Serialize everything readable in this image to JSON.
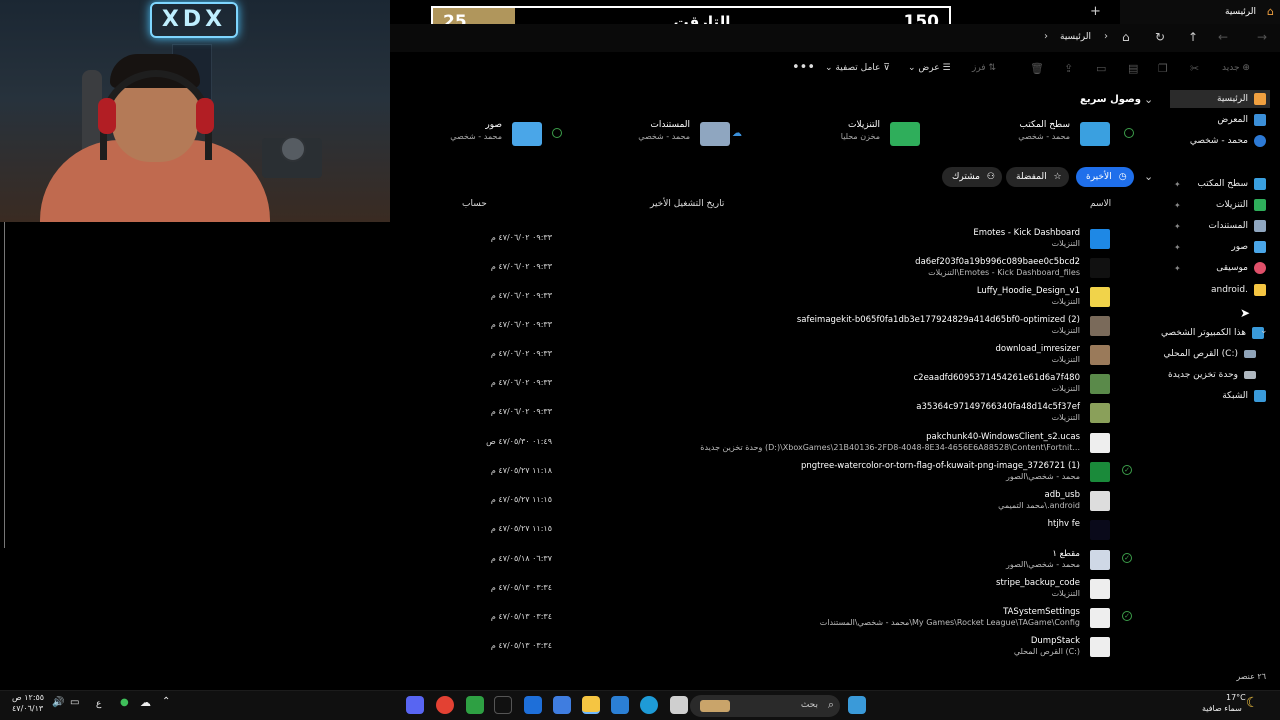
{
  "score": {
    "left_value": "25",
    "title": "التارقت",
    "right_value": "150"
  },
  "window": {
    "tab_title": "الرئيسية",
    "address_crumb": "الرئيسية",
    "toolbar": {
      "new_label": "جديد",
      "sort_label": "فرز",
      "view_label": "عرض",
      "filter_label": "عامل تصفية"
    }
  },
  "sidebar": {
    "items": [
      {
        "label": "الرئيسية",
        "active": true
      },
      {
        "label": "المعرض"
      },
      {
        "label": "محمد - شخصي"
      },
      {
        "label": "سطح المكتب"
      },
      {
        "label": "التنزيلات"
      },
      {
        "label": "المستندات"
      },
      {
        "label": "صور"
      },
      {
        "label": "موسيقى"
      },
      {
        "label": "android."
      },
      {
        "label": "هذا الكمبيوتر الشخصي"
      },
      {
        "label": "القرص المحلي (C:)"
      },
      {
        "label": "وحدة تخزين جديدة"
      },
      {
        "label": "الشبكة"
      }
    ]
  },
  "quick_access": {
    "title": "وصول سريع",
    "cards": [
      {
        "name": "سطح المكتب",
        "sub": "محمد - شخصي"
      },
      {
        "name": "التنزيلات",
        "sub": "مخزن محليا"
      },
      {
        "name": "المستندات",
        "sub": "محمد - شخصي"
      },
      {
        "name": "صور",
        "sub": "محمد - شخصي"
      }
    ]
  },
  "filters": {
    "recent": "الأخيرة",
    "favorites": "المفضلة",
    "shared": "مشترك"
  },
  "columns": {
    "name": "الاسم",
    "last_opened": "تاريخ التشغيل الأخير",
    "account": "حساب"
  },
  "files": [
    {
      "name": "Emotes - Kick Dashboard",
      "loc": "التنزيلات",
      "date": "٠٩:٣٣ ٤٧/٠٦/٠٢ م",
      "color": "#1e88e5"
    },
    {
      "name": "da6ef203f0a19b996c089baee0c5bcd2",
      "loc": "التنزيلات\\Emotes - Kick Dashboard_files",
      "date": "٠٩:٣٣ ٤٧/٠٦/٠٢ م",
      "color": "#111"
    },
    {
      "name": "Luffy_Hoodie_Design_v1",
      "loc": "التنزيلات",
      "date": "٠٩:٣٣ ٤٧/٠٦/٠٢ م",
      "color": "#f1d34a"
    },
    {
      "name": "safeimagekit-b065f0fa1db3e177924829a414d65bf0-optimized (2)",
      "loc": "التنزيلات",
      "date": "٠٩:٣٣ ٤٧/٠٦/٠٢ م",
      "color": "#7a6a5a"
    },
    {
      "name": "download_imresizer",
      "loc": "التنزيلات",
      "date": "٠٩:٣٣ ٤٧/٠٦/٠٢ م",
      "color": "#9a7a5a"
    },
    {
      "name": "c2eaadfd6095371454261e61d6a7f480",
      "loc": "التنزيلات",
      "date": "٠٩:٣٣ ٤٧/٠٦/٠٢ م",
      "color": "#5a8a4a"
    },
    {
      "name": "a35364c97149766340fa48d14c5f37ef",
      "loc": "التنزيلات",
      "date": "٠٩:٣٣ ٤٧/٠٦/٠٢ م",
      "color": "#8aa05a"
    },
    {
      "name": "pakchunk40-WindowsClient_s2.ucas",
      "loc": "وحدة تخزين جديدة (D:)\\XboxGames\\21B40136-2FD8-4048-8E34-4656E6A88528\\Content\\Fortnit...",
      "date": "٠١:٤٩ ٤٧/٠٥/٣٠ ص",
      "color": "#eee"
    },
    {
      "name": "pngtree-watercolor-or-torn-flag-of-kuwait-png-image_3726721 (1)",
      "loc": "محمد - شخصي\\الصور",
      "date": "١١:١٨ ٤٧/٠٥/٢٧ م",
      "color": "#1a8a3a",
      "sync": true
    },
    {
      "name": "adb_usb",
      "loc": "محمد التميمي\\.android",
      "date": "١١:١٥ ٤٧/٠٥/٢٧ م",
      "color": "#ddd"
    },
    {
      "name": "htjhv fe",
      "loc": "",
      "date": "١١:١٥ ٤٧/٠٥/٢٧ م",
      "color": "#0a0a1a"
    },
    {
      "name": "مقطع ١",
      "loc": "محمد - شخصي\\الصور",
      "date": "٠٦:٣٧ ٤٧/٠٥/١٨ م",
      "color": "#cfd8e6",
      "sync": true
    },
    {
      "name": "stripe_backup_code",
      "loc": "التنزيلات",
      "date": "٠٣:٣٤ ٤٧/٠٥/١٣ م",
      "color": "#eee"
    },
    {
      "name": "TASystemSettings",
      "loc": "محمد - شخصي\\المستندات\\My Games\\Rocket League\\TAGame\\Config",
      "date": "٠٣:٣٤ ٤٧/٠٥/١٣ م",
      "color": "#eee",
      "sync": true
    },
    {
      "name": "DumpStack",
      "loc": "القرص المحلي (C:)",
      "date": "٠٣:٣٤ ٤٧/٠٥/١٣ م",
      "color": "#eee"
    }
  ],
  "status": {
    "count": "٢٦ عنصر"
  },
  "taskbar": {
    "time": "١٢:٥٥ ص",
    "date": "٤٧/٠٦/١٣",
    "lang": "ع",
    "search_placeholder": "بحث",
    "weather_temp": "17°C",
    "weather_text": "سماء صافية"
  }
}
